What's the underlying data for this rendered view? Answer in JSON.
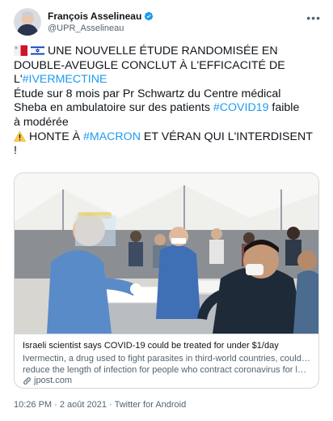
{
  "author": {
    "name": "François Asselineau",
    "handle": "@UPR_Asselineau"
  },
  "tweet": {
    "line1_text": "UNE NOUVELLE ÉTUDE RANDOMISÉE EN",
    "line2": "DOUBLE-AVEUGLE CONCLUT À L'EFFICACITÉ DE",
    "line3_pre": "L'",
    "tag_ivermectine": "#IVERMECTINE",
    "line4": "Étude sur 8 mois par Pr Schwartz du Centre médical",
    "line5_pre": "Sheba en ambulatoire sur des patients ",
    "tag_covid": "#COVID19",
    "line5_post": " faible",
    "line6": "à modérée",
    "line7_pre": "HONTE À ",
    "tag_macron": "#MACRON",
    "line7_post": " ET VÉRAN QUI L'INTERDISENT",
    "line8": "!"
  },
  "card": {
    "title": "Israeli scientist says COVID-19 could be treated for under $1/day",
    "desc1": "Ivermectin, a drug used to fight parasites in third-world countries, could help",
    "desc2": "reduce the length of infection for people who contract coronavirus for less than...",
    "domain": "jpost.com"
  },
  "meta": {
    "time": "10:26 PM",
    "sep1": " · ",
    "date": "2 août 2021",
    "sep2": " · ",
    "source": "Twitter for Android"
  },
  "icons": {
    "more": "more-icon",
    "verified": "verified-icon",
    "link": "link-icon",
    "flag_mt": "flag-malta-icon",
    "flag_il": "flag-israel-icon",
    "warning": "warning-icon"
  },
  "colors": {
    "link": "#1d9bf0",
    "secondary": "#536471",
    "border": "#cfd9de"
  }
}
